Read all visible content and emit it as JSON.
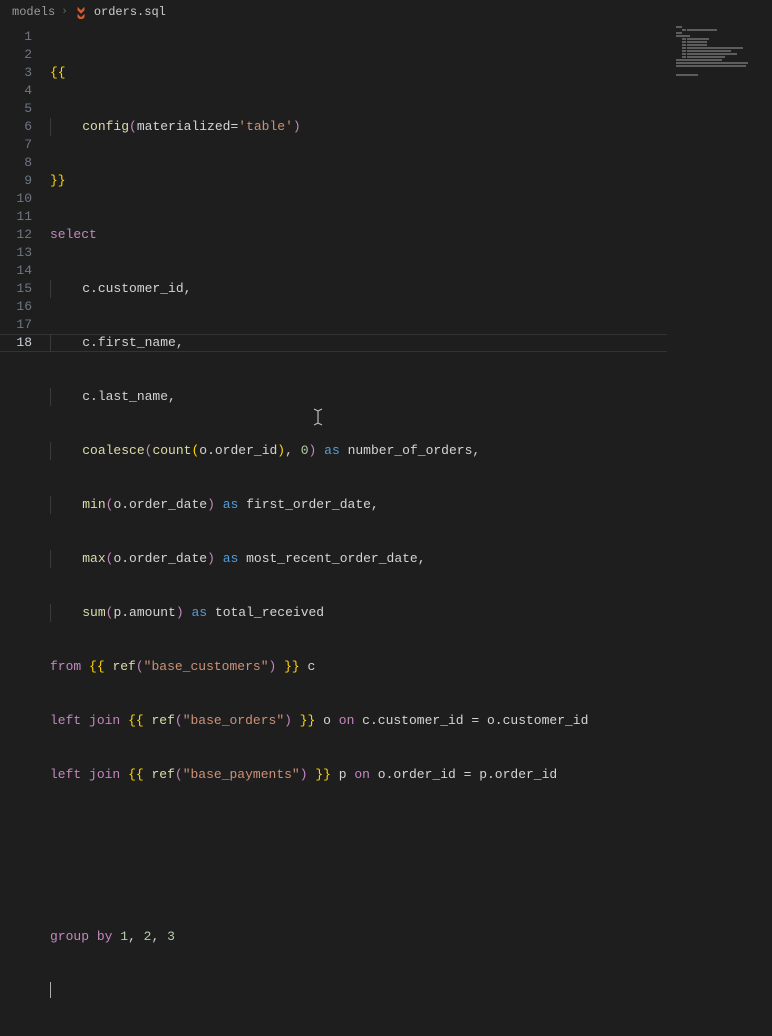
{
  "breadcrumb": {
    "folder": "models",
    "file": "orders.sql"
  },
  "gutter": {
    "lines": [
      "1",
      "2",
      "3",
      "4",
      "5",
      "6",
      "7",
      "8",
      "9",
      "10",
      "11",
      "12",
      "13",
      "14",
      "15",
      "16",
      "17",
      "18"
    ],
    "activeLine": 18
  },
  "code": {
    "l1_brace": "{{",
    "l2_indent": "    ",
    "l2_fn": "config",
    "l2_p1": "(",
    "l2_arg": "materialized",
    "l2_eq": "=",
    "l2_str": "'table'",
    "l2_p2": ")",
    "l3_brace": "}}",
    "l4_kw": "select",
    "l5_indent": "    ",
    "l5_txt": "c.customer_id,",
    "l6_indent": "    ",
    "l6_txt": "c.first_name,",
    "l7_indent": "    ",
    "l7_txt": "c.last_name,",
    "l8_indent": "    ",
    "l8_fn1": "coalesce",
    "l8_p1": "(",
    "l8_fn2": "count",
    "l8_p2": "(",
    "l8_arg": "o.order_id",
    "l8_p3": ")",
    "l8_comma": ", ",
    "l8_num": "0",
    "l8_p4": ")",
    "l8_sp": " ",
    "l8_as": "as",
    "l8_alias": " number_of_orders,",
    "l9_indent": "    ",
    "l9_fn": "min",
    "l9_p1": "(",
    "l9_arg": "o.order_date",
    "l9_p2": ")",
    "l9_sp": " ",
    "l9_as": "as",
    "l9_alias": " first_order_date,",
    "l10_indent": "    ",
    "l10_fn": "max",
    "l10_p1": "(",
    "l10_arg": "o.order_date",
    "l10_p2": ")",
    "l10_sp": " ",
    "l10_as": "as",
    "l10_alias": " most_recent_order_date,",
    "l11_indent": "    ",
    "l11_fn": "sum",
    "l11_p1": "(",
    "l11_arg": "p.amount",
    "l11_p2": ")",
    "l11_sp": " ",
    "l11_as": "as",
    "l11_alias": " total_received",
    "l12_kw": "from",
    "l12_sp1": " ",
    "l12_br1": "{{",
    "l12_sp2": " ",
    "l12_fn": "ref",
    "l12_p1": "(",
    "l12_str": "\"base_customers\"",
    "l12_p2": ")",
    "l12_sp3": " ",
    "l12_br2": "}}",
    "l12_alias": " c",
    "l13_kw1": "left",
    "l13_sp1": " ",
    "l13_kw2": "join",
    "l13_sp2": " ",
    "l13_br1": "{{",
    "l13_sp3": " ",
    "l13_fn": "ref",
    "l13_p1": "(",
    "l13_str": "\"base_orders\"",
    "l13_p2": ")",
    "l13_sp4": " ",
    "l13_br2": "}}",
    "l13_mid": " o ",
    "l13_on": "on",
    "l13_cond": " c.customer_id = o.customer_id",
    "l14_kw1": "left",
    "l14_sp1": " ",
    "l14_kw2": "join",
    "l14_sp2": " ",
    "l14_br1": "{{",
    "l14_sp3": " ",
    "l14_fn": "ref",
    "l14_p1": "(",
    "l14_str": "\"base_payments\"",
    "l14_p2": ")",
    "l14_sp4": " ",
    "l14_br2": "}}",
    "l14_mid": " p ",
    "l14_on": "on",
    "l14_cond": " o.order_id = p.order_id",
    "l17_kw1": "group",
    "l17_sp1": " ",
    "l17_kw2": "by",
    "l17_sp2": " ",
    "l17_n1": "1",
    "l17_c1": ", ",
    "l17_n2": "2",
    "l17_c2": ", ",
    "l17_n3": "3"
  }
}
